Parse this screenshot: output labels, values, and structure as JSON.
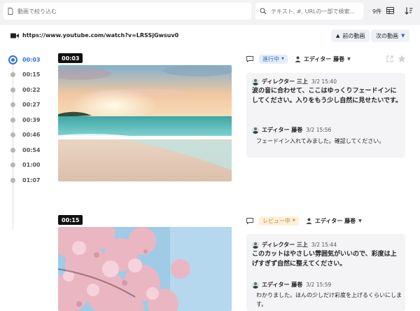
{
  "toolbar": {
    "filter_placeholder": "動画で絞り込む",
    "search_placeholder": "テキスト, #, URLの一部で検索...",
    "count": "9件"
  },
  "url_row": {
    "url": "https://www.youtube.com/watch?v=LRSSjGwsuv0",
    "prev_label": "前の動画",
    "next_label": "次の動画"
  },
  "timeline": {
    "items": [
      {
        "time": "00:03",
        "active": true
      },
      {
        "time": "00:15",
        "active": false
      },
      {
        "time": "00:22",
        "active": false
      },
      {
        "time": "00:27",
        "active": false
      },
      {
        "time": "00:39",
        "active": false
      },
      {
        "time": "00:46",
        "active": false
      },
      {
        "time": "00:54",
        "active": false
      },
      {
        "time": "01:00",
        "active": false
      },
      {
        "time": "01:07",
        "active": false
      }
    ]
  },
  "entries": [
    {
      "timecode": "00:03",
      "status": "進行中",
      "status_colors": {
        "bg": "#e4edfb",
        "fg": "#3a6fc4"
      },
      "assignee": "エディター 藤巻",
      "comments": [
        {
          "author": "ディレクター 三上",
          "time": "3/2 15:40",
          "body": "波の音に合わせて、ここはゆっくりフェードインにしてください。入りをもう少し自然に見せたいです。"
        },
        {
          "author": "エディター 藤巻",
          "time": "3/2 15:56",
          "body": "フェードイン入れてみました。確認してください。"
        }
      ]
    },
    {
      "timecode": "00:15",
      "status": "レビュー中",
      "status_colors": {
        "bg": "#fdf0dc",
        "fg": "#d08a1e"
      },
      "assignee": "エディター 藤巻",
      "comments": [
        {
          "author": "ディレクター 三上",
          "time": "3/2 15:44",
          "body": "このカットはやさしい雰囲気がいいので、彩度は上げすぎず自然に整えてください。"
        },
        {
          "author": "エディター 藤巻",
          "time": "3/2 15:59",
          "body": "わかりました。ほんの少しだけ彩度を上げるくらいにします。"
        }
      ]
    }
  ]
}
